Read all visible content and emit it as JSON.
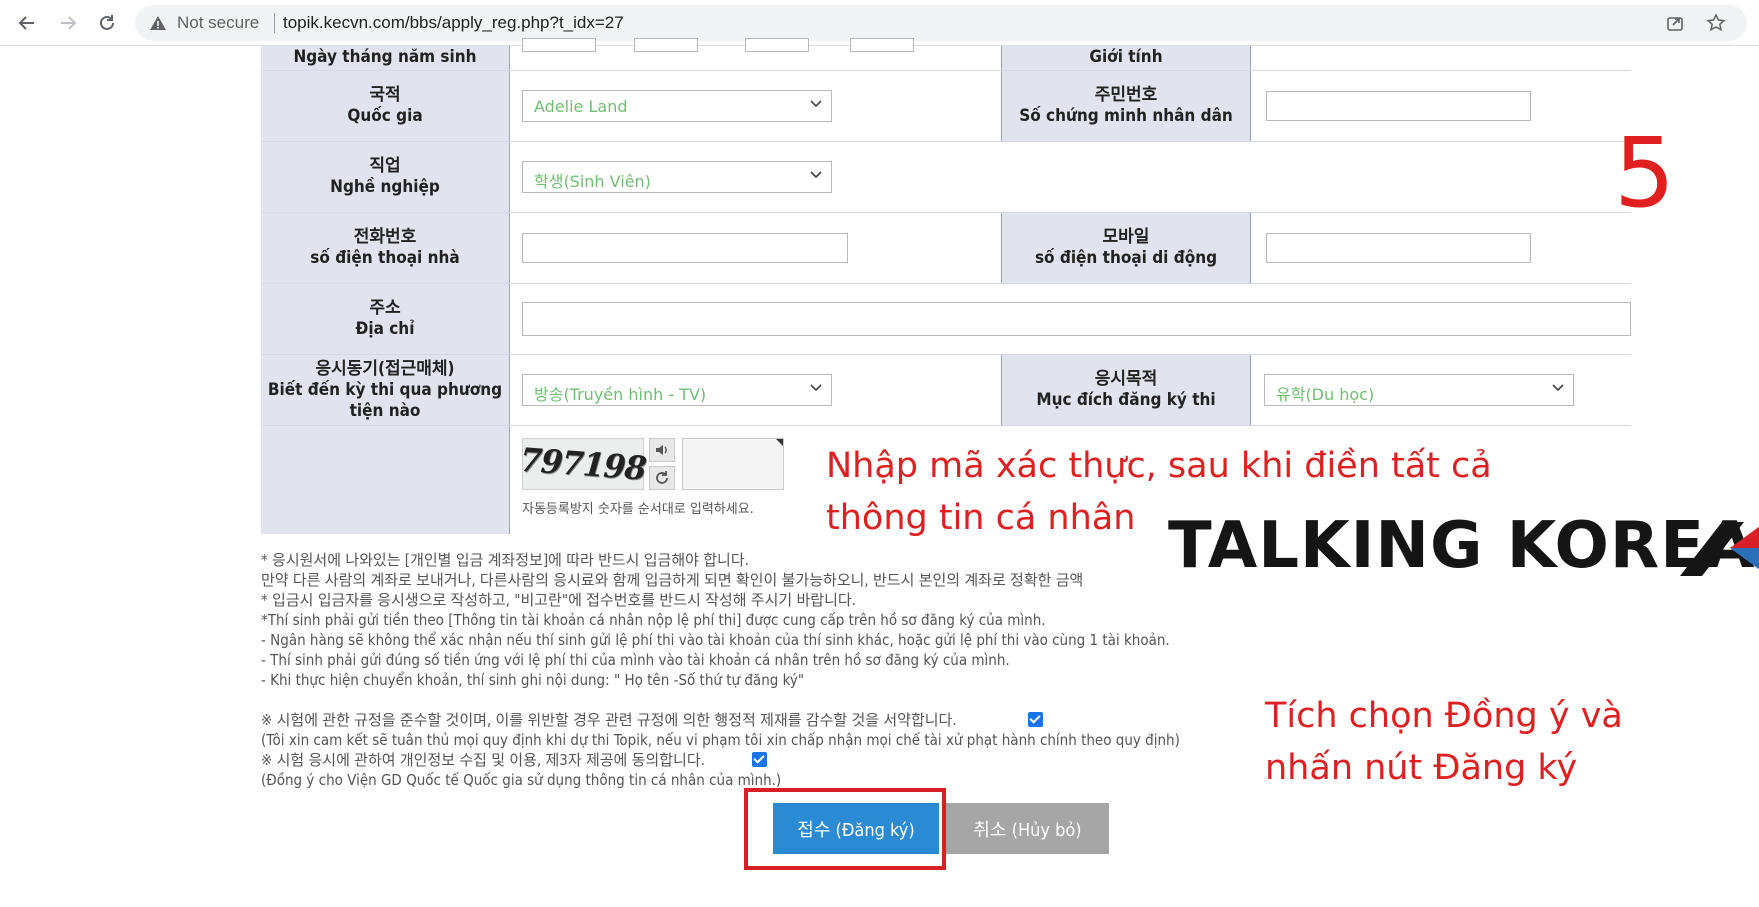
{
  "browser": {
    "security_label": "Not secure",
    "url": "topik.kecvn.com/bbs/apply_reg.php?t_idx=27"
  },
  "form": {
    "dob_label": "Ngày tháng năm sinh",
    "gender_label": "Giới tính",
    "nationality_ko": "국적",
    "nationality_vi": "Quốc gia",
    "nationality_value": "Adelie Land",
    "id_ko": "주민번호",
    "id_vi": "Số chứng minh nhân dân",
    "job_ko": "직업",
    "job_vi": "Nghề nghiệp",
    "job_value": "학생(Sinh Viên)",
    "phone_ko": "전화번호",
    "phone_vi": "số điện thoại nhà",
    "mobile_ko": "모바일",
    "mobile_vi": "số điện thoại di động",
    "address_ko": "주소",
    "address_vi": "Địa chỉ",
    "motive_ko": "응시동기(접근매체)",
    "motive_vi_1": "Biết đến kỳ thi qua phương",
    "motive_vi_2": "tiện nào",
    "motive_value": "방송(Truyền hình - TV)",
    "purpose_ko": "응시목적",
    "purpose_vi": "Mục đích đăng ký thi",
    "purpose_value": "유학(Du học)",
    "captcha_text": "797198",
    "captcha_hint": "자동등록방지 숫자를 순서대로 입력하세요."
  },
  "notes": [
    "* 응시원서에 나와있는 [개인별 입금 계좌정보]에 따라 반드시 입금해야 합니다.",
    "만약 다른 사람의 계좌로 보내거나, 다른사람의 응시료와 함께 입금하게 되면 확인이 불가능하오니, 반드시 본인의 계좌로 정확한 금액",
    "* 입금시 입금자를 응시생으로 작성하고, \"비고란\"에 접수번호를 반드시 작성해 주시기 바랍니다.",
    "*Thí sinh phải gửi tiền theo [Thông tin tài khoản cá nhân nộp lệ phí thi] được cung cấp trên hồ sơ đăng ký của mình.",
    "- Ngân hàng sẽ không thể xác nhận nếu thí sinh gửi lệ phí thi vào tài khoản của thí sinh khác, hoặc gửi lệ phí thi vào cùng 1 tài khoản.",
    "- Thí sinh phải gửi đúng số tiền ứng với lệ phí thi của mình vào tài khoản cá nhân trên hồ sơ đăng ký của mình.",
    "- Khi thực hiện chuyển khoản, thí sinh ghi nội dung: \" Họ tên -Số thứ tự đăng ký\""
  ],
  "agreements": {
    "rule_ko": "※ 시험에 관한 규정을 준수할 것이며, 이를 위반할 경우 관련 규정에 의한 행정적 제재를 감수할 것을 서약합니다.",
    "rule_vi": "(Tôi xin cam kết sẽ tuân thủ mọi quy định khi dự thi Topik, nếu vi phạm tôi xin chấp nhận mọi chế tài xử phạt hành chính theo quy định)",
    "privacy_ko": "※ 시험 응시에 관하여 개인정보 수집 및 이용, 제3자 제공에 동의합니다.",
    "privacy_vi": "(Đồng ý cho Viện GD Quốc tế Quốc gia sử dụng thông tin cá nhân của mình.)"
  },
  "buttons": {
    "submit": "접수 (Đăng ký)",
    "cancel": "취소 (Hủy bỏ)"
  },
  "annotations": {
    "step_number": "5",
    "captcha_note_1": "Nhập mã xác thực, sau khi điền tất cả",
    "captcha_note_2": "thông tin cá nhân",
    "logo": "TALKING KOREA",
    "agree_note_1": "Tích chọn Đồng ý và",
    "agree_note_2": "nhấn nút Đăng ký"
  },
  "colors": {
    "label_bg": "#e1e4ee",
    "submit_bg": "#2a8ad4",
    "cancel_bg": "#a6a6a6",
    "annotation_red": "#e02020",
    "select_text": "#6fbf73"
  }
}
